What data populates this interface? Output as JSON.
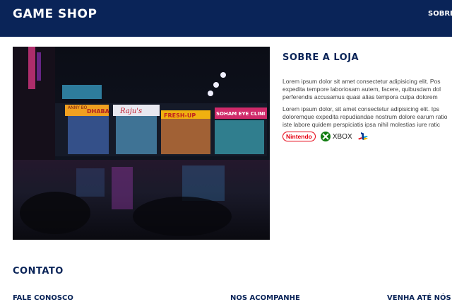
{
  "header": {
    "brand": "GAME SHOP",
    "nav": [
      "SOBRE"
    ]
  },
  "hero": {
    "signs": [
      "ANNY BO",
      "DHABA",
      "Raju's",
      "FRESH-UP",
      "SOHAM EYE CLINI"
    ]
  },
  "about": {
    "title": "SOBRE A LOJA",
    "paragraph1_lines": [
      "Lorem ipsum dolor sit amet consectetur adipisicing elit. Pos",
      "expedita tempore laboriosam autem, facere, quibusdam dol",
      "perferendis accusamus quasi alias tempora culpa dolorem"
    ],
    "paragraph2_lines": [
      "Lorem ipsum dolor, sit amet consectetur adipisicing elit. Ips",
      "doloremque expedita repudiandae nostrum dolore earum ratio",
      "iste labore quidem perspiciatis ipsa nihil molestias iure ratic"
    ],
    "brands": {
      "nintendo": "Nintendo",
      "xbox": "XBOX"
    }
  },
  "contact": {
    "title": "CONTATO",
    "columns": [
      "FALE CONOSCO",
      "NOS ACOMPANHE",
      "VENHA ATÉ NÓS"
    ]
  },
  "colors": {
    "primary": "#0a2458",
    "nintendo": "#e60012",
    "xbox": "#107c10",
    "playstation": "#003791"
  }
}
